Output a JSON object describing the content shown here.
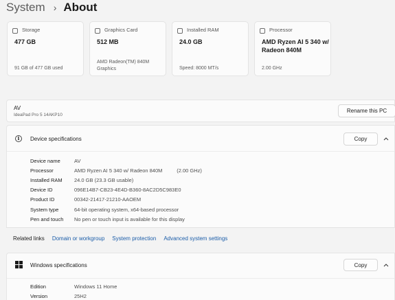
{
  "breadcrumb": {
    "parent": "System",
    "separator": "›",
    "current": "About"
  },
  "cards": [
    {
      "icon": "storage-icon",
      "label": "Storage",
      "value": "477 GB",
      "sub": "91 GB of 477 GB used"
    },
    {
      "icon": "graphics-card-icon",
      "label": "Graphics Card",
      "value": "512 MB",
      "sub": "AMD Radeon(TM) 840M Graphics"
    },
    {
      "icon": "ram-icon",
      "label": "Installed RAM",
      "value": "24.0 GB",
      "sub": "Speed: 8000 MT/s"
    },
    {
      "icon": "processor-icon",
      "label": "Processor",
      "value": "AMD Ryzen AI 5 340 w/ Radeon 840M",
      "sub": "2.00 GHz"
    }
  ],
  "device": {
    "name": "AV",
    "model": "IdeaPad Pro 5 14AKP10",
    "rename_label": "Rename this PC"
  },
  "device_specs": {
    "title": "Device specifications",
    "copy_label": "Copy",
    "rows": [
      {
        "key": "Device name",
        "value": "AV"
      },
      {
        "key": "Processor",
        "value": "AMD Ryzen AI 5 340 w/ Radeon 840M          (2.00 GHz)"
      },
      {
        "key": "Installed RAM",
        "value": "24.0 GB (23.3 GB usable)"
      },
      {
        "key": "Device ID",
        "value": "096E14B7-CB23-4E4D-B360-8AC2D5C983E0"
      },
      {
        "key": "Product ID",
        "value": "00342-21417-21210-AAOEM"
      },
      {
        "key": "System type",
        "value": "64-bit operating system, x64-based processor"
      },
      {
        "key": "Pen and touch",
        "value": "No pen or touch input is available for this display"
      }
    ]
  },
  "related_links": {
    "title": "Related links",
    "links": [
      "Domain or workgroup",
      "System protection",
      "Advanced system settings"
    ]
  },
  "windows_specs": {
    "title": "Windows specifications",
    "copy_label": "Copy",
    "rows": [
      {
        "key": "Edition",
        "value": "Windows 11 Home"
      },
      {
        "key": "Version",
        "value": "25H2"
      }
    ]
  },
  "colors": {
    "accent_link": "#1a5ca8",
    "card_bg": "#fbfbfb",
    "page_bg": "#f3f3f3"
  }
}
